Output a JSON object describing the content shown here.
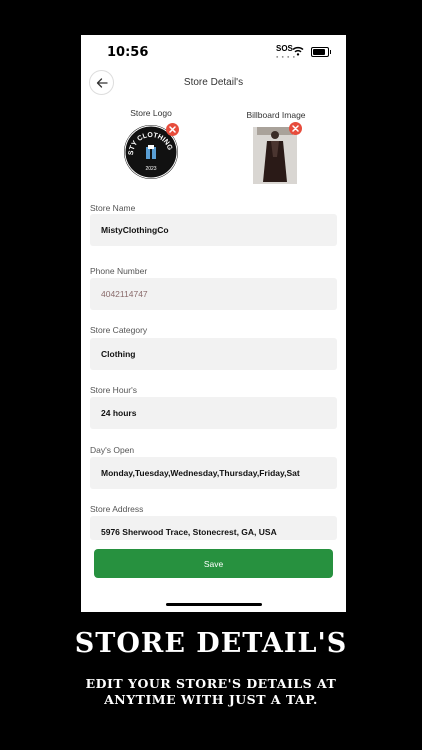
{
  "status_bar": {
    "time": "10:56",
    "sos": "SOS"
  },
  "header": {
    "title": "Store Detail's"
  },
  "images": {
    "logo_label": "Store Logo",
    "billboard_label": "Billboard Image",
    "logo_text_top": "MISTY CLOTHING CO",
    "logo_text_bottom": "2023"
  },
  "fields": [
    {
      "label": "Store Name",
      "value": "MistyClothingCo"
    },
    {
      "label": "Phone Number",
      "value": "4042114747"
    },
    {
      "label": "Store Category",
      "value": "Clothing"
    },
    {
      "label": "Store Hour's",
      "value": "24 hours"
    },
    {
      "label": "Day's Open",
      "value": "Monday,Tuesday,Wednesday,Thursday,Friday,Sat"
    },
    {
      "label": "Store Address",
      "value": "5976 Sherwood Trace, Stonecrest, GA, USA"
    }
  ],
  "save_label": "Save",
  "promo": {
    "title": "STORE DETAIL'S",
    "subtitle_line1": "EDIT YOUR STORE'S DETAILS AT",
    "subtitle_line2": "ANYTIME WITH JUST A TAP."
  },
  "colors": {
    "accent": "#27913f",
    "remove": "#e74c3c",
    "field_bg": "#f2f2f2"
  }
}
